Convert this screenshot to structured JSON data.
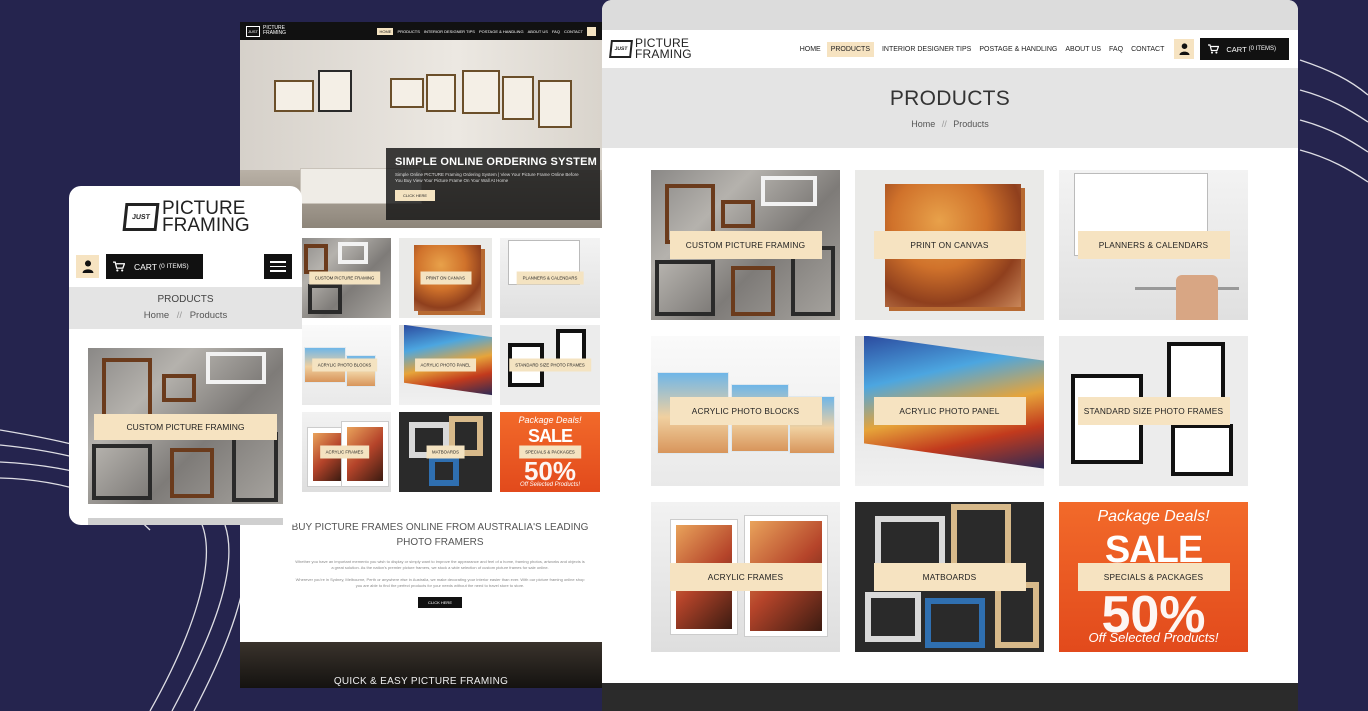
{
  "brand": {
    "logo_mark": "JUST",
    "logo_line1": "PICTURE",
    "logo_line2": "FRAMING"
  },
  "colors": {
    "background": "#25244e",
    "accent": "#f6e3c1",
    "dark": "#111111",
    "sale_orange": "#f26a2a"
  },
  "nav": {
    "items": [
      {
        "label": "HOME",
        "active": false
      },
      {
        "label": "PRODUCTS",
        "active": true
      },
      {
        "label": "INTERIOR DESIGNER TIPS",
        "active": false
      },
      {
        "label": "POSTAGE & HANDLING",
        "active": false
      },
      {
        "label": "ABOUT US",
        "active": false
      },
      {
        "label": "FAQ",
        "active": false
      },
      {
        "label": "CONTACT",
        "active": false
      }
    ],
    "user_icon": "user-icon",
    "cart_icon": "cart-icon",
    "cart_label": "CART",
    "cart_count": "(0 ITEMS)"
  },
  "products_page": {
    "title": "PRODUCTS",
    "breadcrumb": {
      "home": "Home",
      "separator": "//",
      "current": "Products"
    },
    "tiles": [
      {
        "label": "CUSTOM PICTURE FRAMING"
      },
      {
        "label": "PRINT ON CANVAS"
      },
      {
        "label": "PLANNERS & CALENDARS"
      },
      {
        "label": "ACRYLIC PHOTO BLOCKS"
      },
      {
        "label": "ACRYLIC PHOTO PANEL"
      },
      {
        "label": "STANDARD SIZE PHOTO FRAMES"
      },
      {
        "label": "ACRYLIC FRAMES"
      },
      {
        "label": "MATBOARDS"
      },
      {
        "label": "SPECIALS & PACKAGES"
      }
    ],
    "sale_art": {
      "line1": "Package Deals!",
      "line2": "SALE",
      "line3": "50%",
      "line4": "Off Selected Products!"
    }
  },
  "home_page": {
    "hero_title": "SIMPLE ONLINE ORDERING SYSTEM",
    "hero_sub": "Simple Online PICTURE Framing Ordering System | View Your Picture Frame Online Before You Buy View Your Picture Frame On Your Wall At Home",
    "hero_button": "CLICK HERE",
    "heading": "BUY PICTURE FRAMES ONLINE FROM AUSTRALIA'S LEADING PHOTO FRAMERS",
    "para1": "Whether you have an important memento you wish to display or simply want to improve the appearance and feel of a home, framing photos, artworks and objects is a great solution. As the nation's premier picture framers, we stock a wide selection of custom picture frames for sale online.",
    "para2": "Wherever you're in Sydney, Melbourne, Perth or anywhere else in Australia, we make decorating your interior easier than ever. With our picture framing online shop you are able to find the perfect products for your needs without the need to travel store to store.",
    "button": "CLICK HERE",
    "bottom_title": "QUICK & EASY PICTURE FRAMING"
  },
  "mobile": {
    "title": "PRODUCTS",
    "breadcrumb": {
      "home": "Home",
      "separator": "//",
      "current": "Products"
    },
    "cart_label": "CART",
    "cart_count": "(0 ITEMS)",
    "menu_icon": "hamburger-menu-icon",
    "first_tile": "CUSTOM PICTURE FRAMING"
  }
}
